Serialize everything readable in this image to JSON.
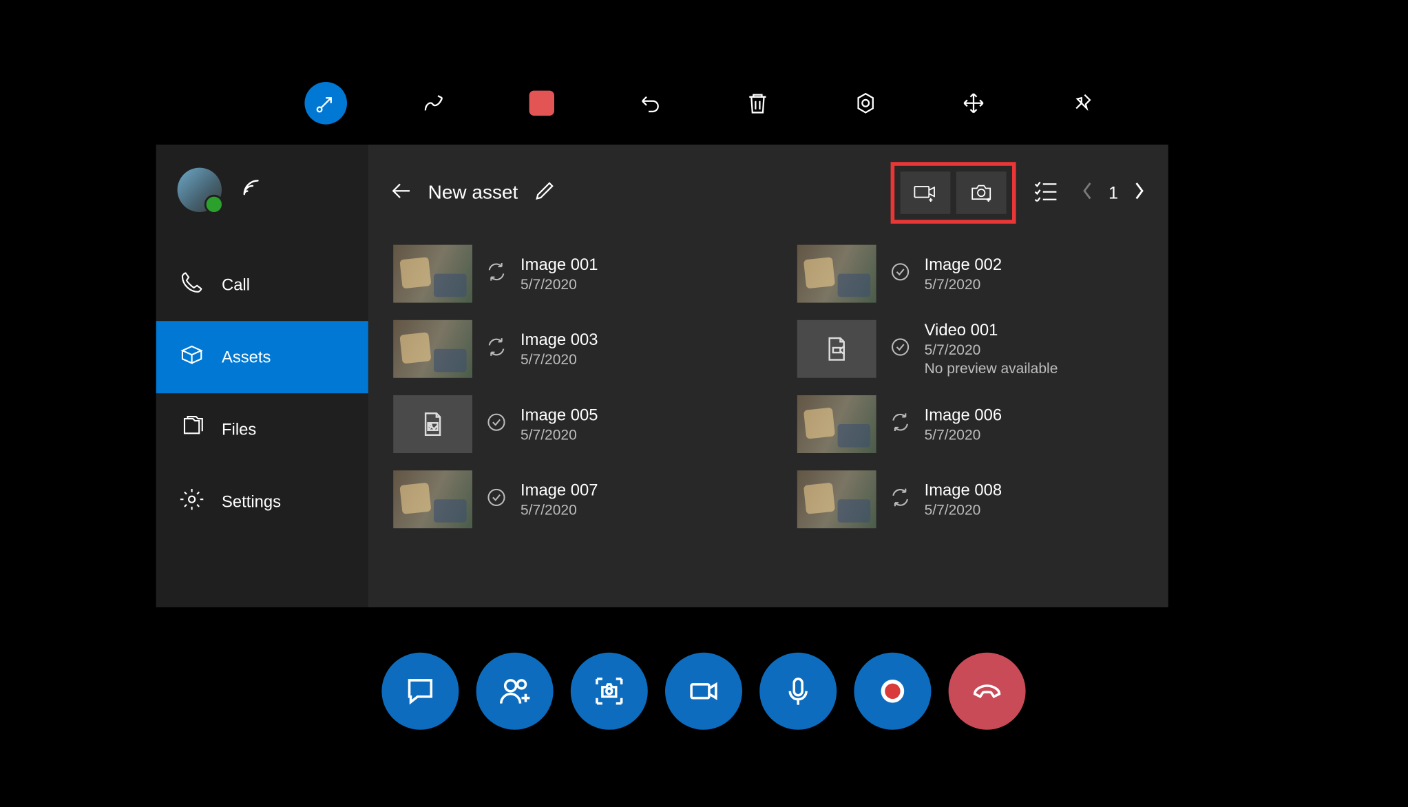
{
  "top_toolbar": {
    "items": [
      {
        "name": "collapse-arrow-icon",
        "active": true
      },
      {
        "name": "ink-icon"
      },
      {
        "name": "stop-icon"
      },
      {
        "name": "undo-icon"
      },
      {
        "name": "trash-icon"
      },
      {
        "name": "settings-hex-icon"
      },
      {
        "name": "move-icon"
      },
      {
        "name": "pin-icon"
      }
    ]
  },
  "sidebar": {
    "nav": [
      {
        "icon": "phone",
        "label": "Call"
      },
      {
        "icon": "box",
        "label": "Assets",
        "active": true
      },
      {
        "icon": "files",
        "label": "Files"
      },
      {
        "icon": "gear",
        "label": "Settings"
      }
    ]
  },
  "header": {
    "title": "New asset",
    "page": "1"
  },
  "assets": [
    {
      "name": "Image 001",
      "date": "5/7/2020",
      "thumb": "photo",
      "status": "sync"
    },
    {
      "name": "Image 002",
      "date": "5/7/2020",
      "thumb": "photo",
      "status": "check"
    },
    {
      "name": "Image 003",
      "date": "5/7/2020",
      "thumb": "photo",
      "status": "sync"
    },
    {
      "name": "Video 001",
      "date": "5/7/2020",
      "thumb": "video-placeholder",
      "status": "check",
      "extra": "No preview available"
    },
    {
      "name": "Image 005",
      "date": "5/7/2020",
      "thumb": "image-placeholder",
      "status": "check"
    },
    {
      "name": "Image 006",
      "date": "5/7/2020",
      "thumb": "photo",
      "status": "sync"
    },
    {
      "name": "Image 007",
      "date": "5/7/2020",
      "thumb": "photo",
      "status": "check"
    },
    {
      "name": "Image 008",
      "date": "5/7/2020",
      "thumb": "photo",
      "status": "sync"
    }
  ]
}
